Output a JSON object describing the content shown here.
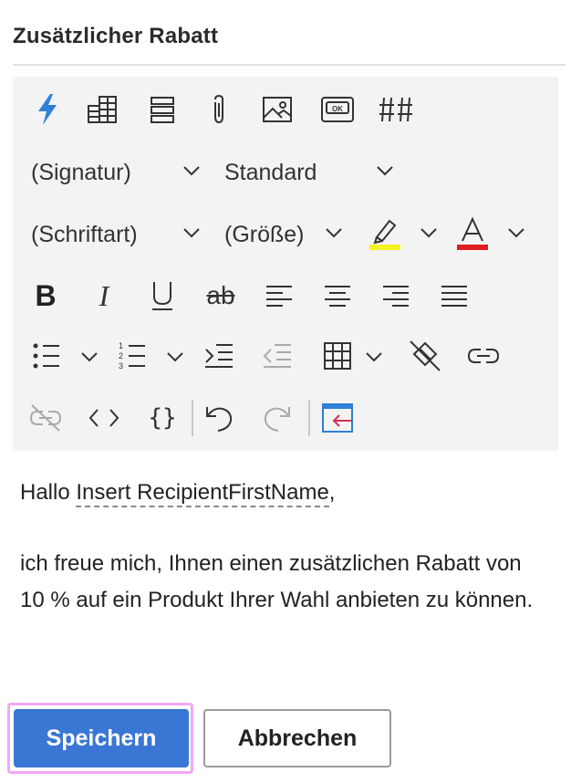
{
  "header": {
    "title": "Zusätzlicher Rabatt"
  },
  "toolbar": {
    "signature_select": "(Signatur)",
    "style_select": "Standard",
    "font_select": "(Schriftart)",
    "size_select": "(Größe)",
    "highlight_color": "#f5f222",
    "font_color": "#e02020",
    "icons": [
      "lightning-icon",
      "insert-field-icon",
      "rows-icon",
      "attachment-icon",
      "image-icon",
      "button-icon",
      "hash-icon",
      "bold-icon",
      "italic-icon",
      "underline-icon",
      "strikethrough-icon",
      "align-left-icon",
      "align-center-icon",
      "align-right-icon",
      "justify-icon",
      "bulleted-list-icon",
      "numbered-list-icon",
      "indent-icon",
      "outdent-icon",
      "table-icon",
      "clear-format-icon",
      "link-icon",
      "unlink-icon",
      "code-icon",
      "braces-icon",
      "undo-icon",
      "redo-icon",
      "insert-template-icon"
    ]
  },
  "editor": {
    "greeting": "Hallo",
    "placeholder": "Insert RecipientFirstName",
    "comma": ",",
    "body": "ich freue mich, Ihnen einen zusätzlichen Rabatt von 10 % auf ein Produkt Ihrer Wahl anbieten zu können."
  },
  "buttons": {
    "save": "Speichern",
    "cancel": "Abbrechen"
  },
  "colors": {
    "accent": "#3a77d4",
    "focus_ring": "#f2a8f2",
    "toolbar_bg": "#f3f3f3"
  }
}
